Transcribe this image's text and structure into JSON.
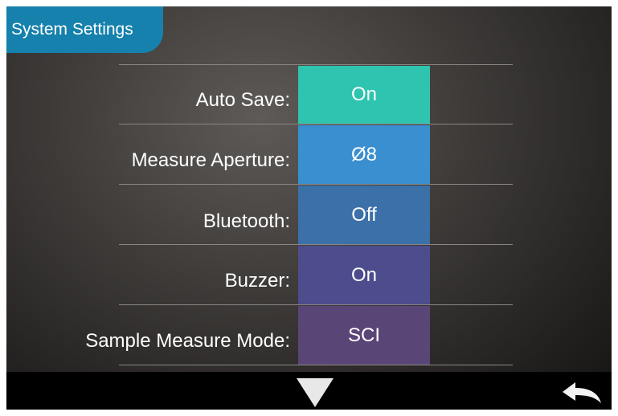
{
  "header": {
    "title": "System Settings"
  },
  "settings": [
    {
      "label": "Auto Save:",
      "value": "On",
      "color": "#2ec4b0"
    },
    {
      "label": "Measure Aperture:",
      "value": "Ø8",
      "color": "#3a8fd0"
    },
    {
      "label": "Bluetooth:",
      "value": "Off",
      "color": "#3b70a8"
    },
    {
      "label": "Buzzer:",
      "value": "On",
      "color": "#4d4c8c"
    },
    {
      "label": "Sample Measure Mode:",
      "value": "SCI",
      "color": "#5a4577"
    }
  ],
  "footer": {
    "down_icon": "triangle-down-icon",
    "back_icon": "return-arrow-icon"
  }
}
